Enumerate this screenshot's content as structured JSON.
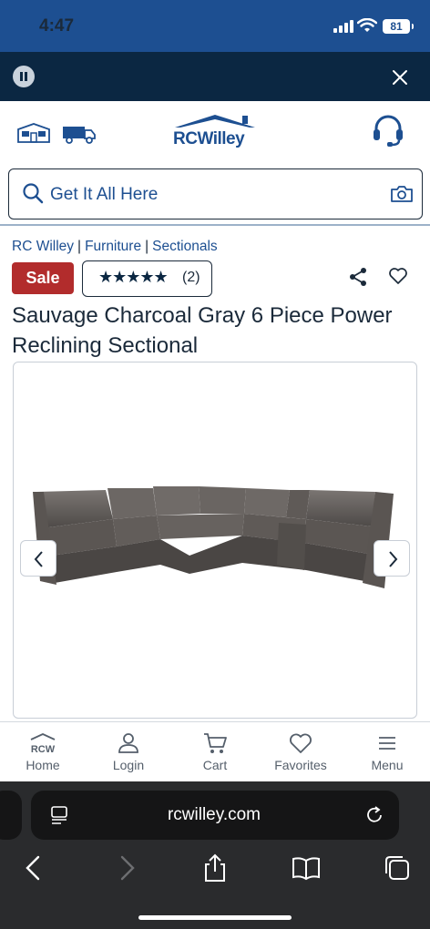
{
  "status_bar": {
    "time": "4:47",
    "battery": "81"
  },
  "header": {
    "logo_text": "RCWilley"
  },
  "search": {
    "placeholder": "Get It All Here"
  },
  "breadcrumb": [
    "RC Willey",
    "Furniture",
    "Sectionals"
  ],
  "product": {
    "sale_label": "Sale",
    "stars": "★★★★★",
    "review_count": "(2)",
    "title": "Sauvage Charcoal Gray 6 Piece Power Reclining Sectional"
  },
  "bottom_nav": {
    "home_mark": "RCW",
    "items": [
      {
        "label": "Home",
        "icon": "home-icon"
      },
      {
        "label": "Login",
        "icon": "user-icon"
      },
      {
        "label": "Cart",
        "icon": "cart-icon"
      },
      {
        "label": "Favorites",
        "icon": "heart-icon"
      },
      {
        "label": "Menu",
        "icon": "menu-icon"
      }
    ]
  },
  "browser": {
    "url": "rcwilley.com"
  },
  "colors": {
    "brand_blue": "#1d4f91",
    "sale_red": "#b22c2c",
    "dark_navy": "#0b2742"
  }
}
